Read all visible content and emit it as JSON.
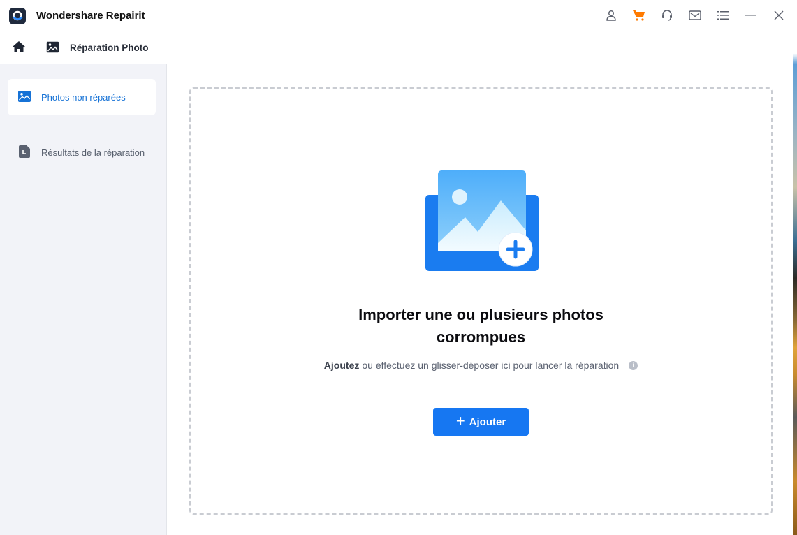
{
  "app": {
    "title": "Wondershare Repairit"
  },
  "titlebar_icons": [
    {
      "name": "account-icon"
    },
    {
      "name": "cart-icon"
    },
    {
      "name": "support-headset-icon"
    },
    {
      "name": "mail-icon"
    },
    {
      "name": "menu-list-icon"
    },
    {
      "name": "minimize-icon"
    },
    {
      "name": "close-icon"
    }
  ],
  "navbar": {
    "title": "Réparation Photo"
  },
  "sidebar": {
    "items": [
      {
        "label": "Photos non réparées",
        "icon": "photo-icon",
        "active": true
      },
      {
        "label": "Résultats de la réparation",
        "icon": "document-icon",
        "active": false
      }
    ]
  },
  "main": {
    "heading_line1": "Importer une ou plusieurs photos",
    "heading_line2": "corrompues",
    "sub_bold": "Ajoutez",
    "sub_rest": "ou effectuez un glisser-déposer ici pour lancer la réparation",
    "info_glyph": "i",
    "add_button": {
      "plus": "+",
      "label": "Ajouter"
    }
  },
  "colors": {
    "accent": "#1677f2",
    "active_sidebar_text": "#1672d6",
    "cart": "#ff7a00"
  }
}
